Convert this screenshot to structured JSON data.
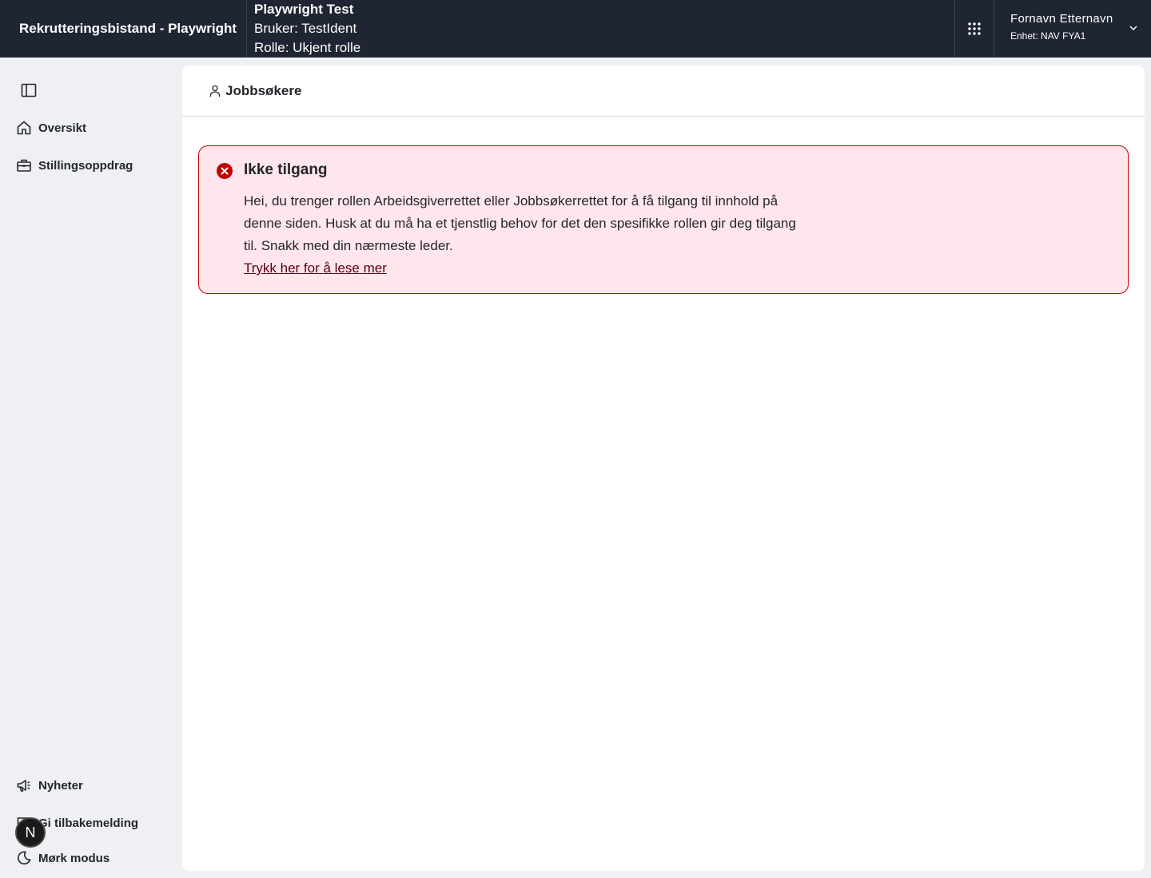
{
  "header": {
    "app_title": "Rekrutteringsbistand - Playwright",
    "env_name": "Playwright Test",
    "env_user": "Bruker: TestIdent",
    "env_role": "Rolle: Ukjent rolle",
    "user_name": "Fornavn Etternavn",
    "user_unit": "Enhet: NAV FYA1"
  },
  "sidebar": {
    "top_items": [
      {
        "label": "Oversikt",
        "icon": "house-icon"
      },
      {
        "label": "Stillingsoppdrag",
        "icon": "briefcase-icon"
      }
    ],
    "bottom_items": [
      {
        "label": "Nyheter",
        "icon": "megaphone-icon"
      },
      {
        "label": "Gi tilbakemelding",
        "icon": "chat-icon"
      },
      {
        "label": "Mørk modus",
        "icon": "moon-icon"
      }
    ],
    "avatar_letter": "N"
  },
  "main": {
    "page_title": "Jobbsøkere",
    "alert": {
      "title": "Ikke tilgang",
      "body": "Hei, du trenger rollen Arbeidsgiverrettet eller Jobbsøkerrettet for å få tilgang til innhold på denne siden. Husk at du må ha et tjenstlig behov for det den spesifikke rollen gir deg tilgang til. Snakk med din nærmeste leder.",
      "link": "Trykk her for å lese mer"
    }
  },
  "colors": {
    "header_bg": "#1f2532",
    "alert_bg": "#ffe6ed",
    "alert_border": "#c30000",
    "error_icon": "#c30000"
  }
}
